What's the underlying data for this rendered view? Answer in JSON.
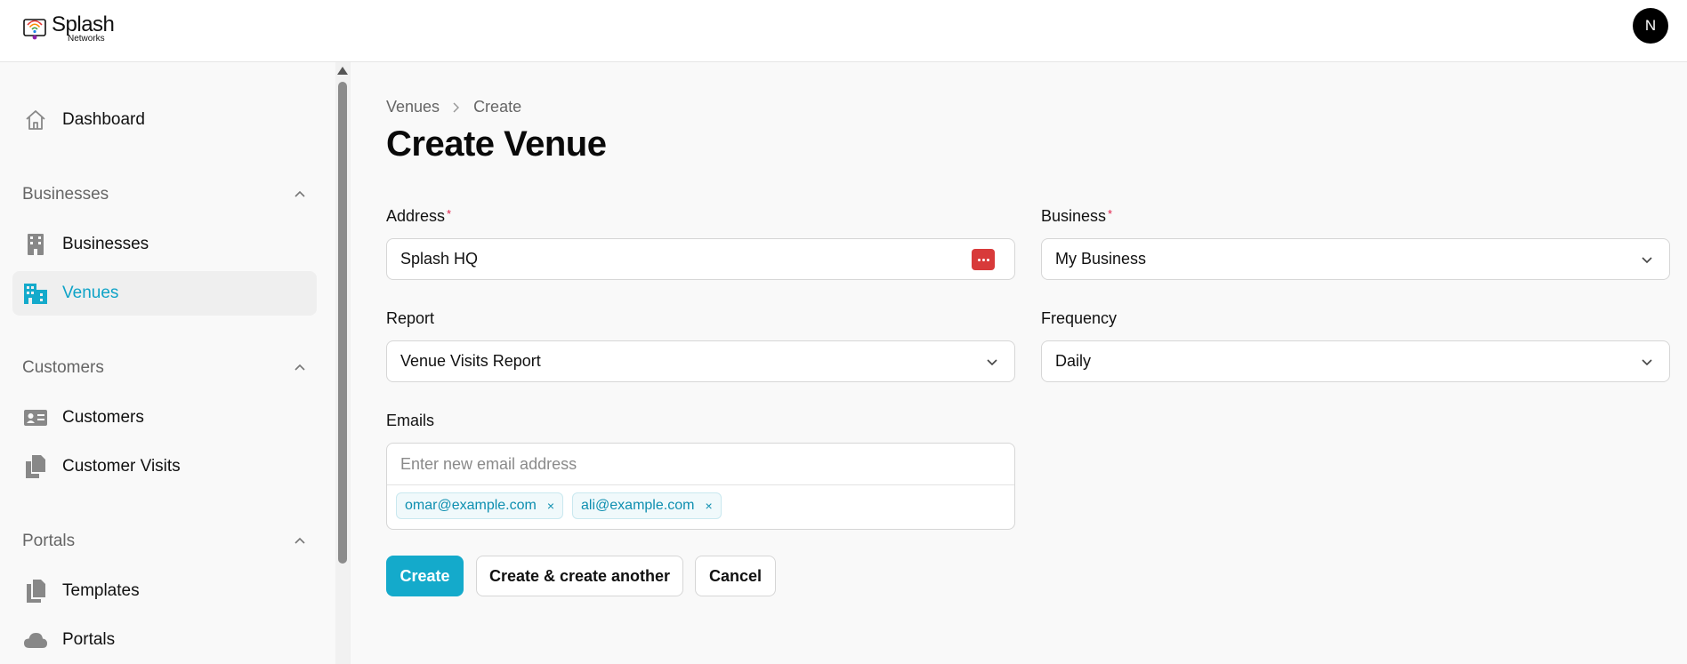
{
  "app": {
    "logo_text": "Splash",
    "logo_sub": "Networks",
    "user_initial": "N"
  },
  "sidebar": {
    "dashboard": "Dashboard",
    "groups": [
      {
        "label": "Businesses",
        "items": [
          {
            "label": "Businesses",
            "icon": "building-icon"
          },
          {
            "label": "Venues",
            "icon": "buildings-icon",
            "active": true
          }
        ]
      },
      {
        "label": "Customers",
        "items": [
          {
            "label": "Customers",
            "icon": "id-card-icon"
          },
          {
            "label": "Customer Visits",
            "icon": "copy-icon"
          }
        ]
      },
      {
        "label": "Portals",
        "items": [
          {
            "label": "Templates",
            "icon": "documents-icon"
          },
          {
            "label": "Portals",
            "icon": "cloud-icon"
          }
        ]
      }
    ]
  },
  "breadcrumb": {
    "parent": "Venues",
    "current": "Create"
  },
  "page": {
    "title": "Create Venue"
  },
  "form": {
    "address": {
      "label": "Address",
      "required_mark": "*",
      "value": "Splash HQ"
    },
    "business": {
      "label": "Business",
      "required_mark": "*",
      "value": "My Business"
    },
    "report": {
      "label": "Report",
      "value": "Venue Visits Report"
    },
    "frequency": {
      "label": "Frequency",
      "value": "Daily"
    },
    "emails": {
      "label": "Emails",
      "placeholder": "Enter new email address",
      "tags": [
        "omar@example.com",
        "ali@example.com"
      ],
      "remove_glyph": "×"
    }
  },
  "actions": {
    "create": "Create",
    "create_another": "Create & create another",
    "cancel": "Cancel"
  },
  "colors": {
    "accent": "#14aacb",
    "active_text": "#0fa3c7",
    "required": "#e11d48"
  }
}
